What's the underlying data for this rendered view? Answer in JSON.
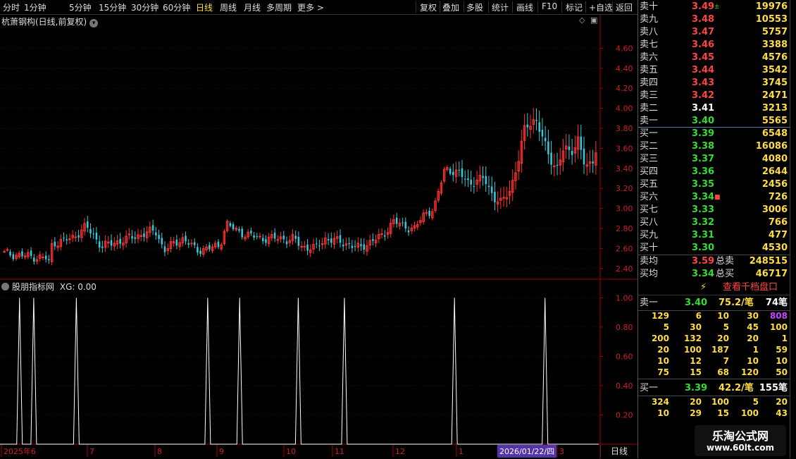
{
  "toolbar": {
    "left": [
      "分时",
      "1分钟",
      "5分钟",
      "15分钟",
      "30分钟",
      "60分钟",
      "日线",
      "周线",
      "月线",
      "多周期",
      "更多 >"
    ],
    "active_index": 6,
    "right": [
      "复权",
      "叠加",
      "多股",
      "统计",
      "画线",
      "F10",
      "标记",
      "+自选",
      "返回"
    ]
  },
  "main": {
    "title": "杭萧钢构(日线,前复权)",
    "indicator_title": "股朋指标网",
    "indicator_value": "XG: 0.00",
    "period_label": "日线"
  },
  "chart_data": [
    {
      "type": "candlestick",
      "title": "杭萧钢构(日线,前复权)",
      "ylim": [
        2.3,
        4.8
      ],
      "yticks": [
        2.4,
        2.6,
        2.8,
        3.0,
        3.2,
        3.4,
        3.6,
        3.8,
        4.0,
        4.2,
        4.4,
        4.6
      ],
      "ytick_labels": [
        "2.40",
        "2.60",
        "2.80",
        "3.00",
        "3.20",
        "3.40",
        "3.60",
        "3.80",
        "4.00",
        "4.20",
        "4.40",
        "4.60"
      ],
      "x_labels": [
        "2025年6",
        "7",
        "8",
        "9",
        "10",
        "11",
        "12",
        "1",
        "2026/01/22/四",
        "3"
      ],
      "n_bars": 200,
      "segments": [
        [
          0,
          2.55
        ],
        [
          24,
          2.5
        ],
        [
          25,
          2.45
        ],
        [
          27,
          2.65
        ],
        [
          38,
          2.7
        ],
        [
          46,
          2.82
        ],
        [
          55,
          2.62
        ],
        [
          70,
          2.7
        ],
        [
          85,
          2.78
        ],
        [
          90,
          2.58
        ],
        [
          100,
          2.7
        ],
        [
          104,
          2.65
        ],
        [
          108,
          2.58
        ],
        [
          121,
          2.62
        ],
        [
          125,
          2.85
        ],
        [
          131,
          2.77
        ],
        [
          144,
          2.7
        ],
        [
          152,
          2.7
        ],
        [
          157,
          2.7
        ],
        [
          160,
          2.68
        ],
        [
          163,
          2.7
        ],
        [
          167,
          2.62
        ],
        [
          175,
          2.6
        ],
        [
          181,
          2.7
        ],
        [
          194,
          2.64
        ],
        [
          200,
          2.6
        ],
        [
          207,
          2.68
        ],
        [
          213,
          2.72
        ],
        [
          219,
          2.88
        ],
        [
          224,
          2.82
        ],
        [
          231,
          2.8
        ],
        [
          237,
          2.95
        ],
        [
          242,
          3.0
        ],
        [
          248,
          3.4
        ],
        [
          256,
          3.35
        ],
        [
          262,
          3.25
        ],
        [
          270,
          3.3
        ],
        [
          276,
          3.1
        ],
        [
          280,
          3.05
        ],
        [
          285,
          3.2
        ],
        [
          289,
          3.45
        ],
        [
          293,
          3.8
        ],
        [
          299,
          3.9
        ],
        [
          303,
          3.7
        ],
        [
          307,
          3.5
        ],
        [
          311,
          3.4
        ],
        [
          315,
          3.6
        ],
        [
          319,
          3.55
        ],
        [
          323,
          3.7
        ],
        [
          327,
          3.4
        ],
        [
          331,
          3.45
        ],
        [
          333,
          3.6
        ]
      ]
    },
    {
      "type": "line",
      "title": "股朋指标网",
      "ylim": [
        0,
        1.05
      ],
      "yticks": [
        0.2,
        0.4,
        0.6,
        0.8,
        1.0
      ],
      "ytick_labels": [
        "0.20",
        "0.40",
        "0.60",
        "0.80",
        "1.00"
      ],
      "signal_bar_indices": [
        11,
        19,
        43,
        117,
        135,
        168,
        194,
        256,
        307
      ],
      "value_range": [
        0,
        1
      ]
    }
  ],
  "orderbook": {
    "asks": [
      {
        "label": "卖十",
        "price": "3.49",
        "vol": "19976"
      },
      {
        "label": "卖九",
        "price": "3.48",
        "vol": "10553"
      },
      {
        "label": "卖八",
        "price": "3.47",
        "vol": "5757"
      },
      {
        "label": "卖七",
        "price": "3.46",
        "vol": "3388"
      },
      {
        "label": "卖六",
        "price": "3.45",
        "vol": "4576"
      },
      {
        "label": "卖五",
        "price": "3.44",
        "vol": "3542"
      },
      {
        "label": "卖四",
        "price": "3.43",
        "vol": "3745"
      },
      {
        "label": "卖三",
        "price": "3.42",
        "vol": "2471"
      },
      {
        "label": "卖二",
        "price": "3.41",
        "vol": "3213"
      },
      {
        "label": "卖一",
        "price": "3.40",
        "vol": "5565"
      }
    ],
    "bids": [
      {
        "label": "买一",
        "price": "3.39",
        "vol": "6548"
      },
      {
        "label": "买二",
        "price": "3.38",
        "vol": "16086"
      },
      {
        "label": "买三",
        "price": "3.37",
        "vol": "4080"
      },
      {
        "label": "买四",
        "price": "3.36",
        "vol": "2644"
      },
      {
        "label": "买五",
        "price": "3.35",
        "vol": "2456"
      },
      {
        "label": "买六",
        "price": "3.34",
        "vol": "726"
      },
      {
        "label": "买七",
        "price": "3.33",
        "vol": "3006"
      },
      {
        "label": "买八",
        "price": "3.32",
        "vol": "766"
      },
      {
        "label": "买九",
        "price": "3.31",
        "vol": "477"
      },
      {
        "label": "买十",
        "price": "3.30",
        "vol": "4530"
      }
    ],
    "ask_avg": {
      "label": "卖均",
      "price": "3.59",
      "total_label": "总卖",
      "total": "248515"
    },
    "bid_avg": {
      "label": "买均",
      "price": "3.34",
      "total_label": "总买",
      "total": "46717"
    },
    "thousand_label": "查看千档盘口",
    "ask1_detail": {
      "label": "卖一",
      "price": "3.40",
      "avg": "75.2/笔",
      "count": "74笔"
    },
    "ask_queue": [
      [
        "129",
        "6",
        "10",
        "30",
        "808"
      ],
      [
        "5",
        "30",
        "5",
        "45",
        "100"
      ],
      [
        "200",
        "132",
        "20",
        "20",
        "1"
      ],
      [
        "20",
        "100",
        "187",
        "1",
        "59"
      ],
      [
        "10",
        "12",
        "7",
        "10",
        "10"
      ],
      [
        "75",
        "15",
        "68",
        "120",
        "50"
      ]
    ],
    "bid1_detail": {
      "label": "买一",
      "price": "3.39",
      "avg": "42.2/笔",
      "count": "155笔"
    },
    "bid_queue": [
      [
        "324",
        "20",
        "100",
        "5",
        "20"
      ],
      [
        "10",
        "29",
        "15",
        "100",
        "43"
      ]
    ]
  },
  "watermark": {
    "line1": "乐淘公式网",
    "line2": "www.60lt.com"
  },
  "colors": {
    "up": "#ff3333",
    "down": "#33ccdd",
    "bg": "#000000",
    "axis": "#cc0000"
  }
}
